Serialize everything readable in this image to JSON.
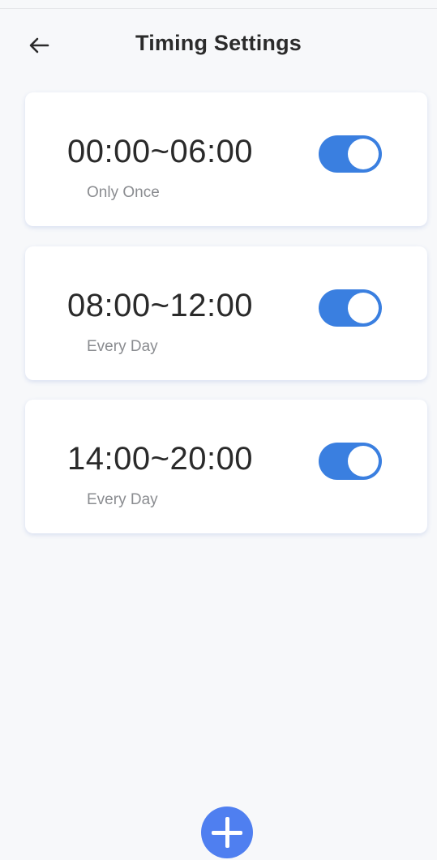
{
  "header": {
    "title": "Timing Settings",
    "back_icon": "arrow-left-icon"
  },
  "schedules": [
    {
      "time_range": "00:00~06:00",
      "repeat": "Only Once",
      "enabled": true
    },
    {
      "time_range": "08:00~12:00",
      "repeat": "Every Day",
      "enabled": true
    },
    {
      "time_range": "14:00~20:00",
      "repeat": "Every Day",
      "enabled": true
    }
  ],
  "add_button": {
    "icon": "plus-icon"
  },
  "colors": {
    "toggle_on": "#3a7fe0",
    "add_button": "#4f7ff0",
    "background": "#f7f8fa"
  }
}
